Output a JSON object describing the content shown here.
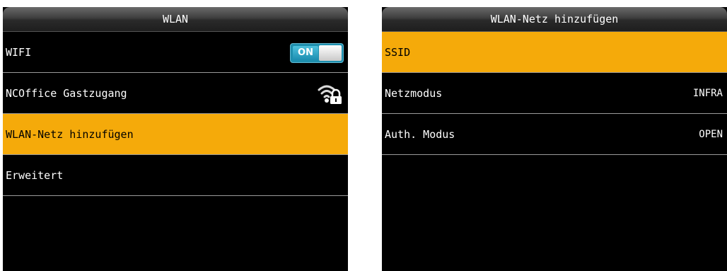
{
  "left_panel": {
    "title": "WLAN",
    "items": [
      {
        "label": "WIFI",
        "toggle": {
          "state_label": "ON",
          "on": true
        }
      },
      {
        "label": "NCOffice Gastzugang",
        "icon": "wifi-lock-icon"
      },
      {
        "label": "WLAN-Netz hinzufügen",
        "selected": true
      },
      {
        "label": "Erweitert"
      }
    ]
  },
  "right_panel": {
    "title": "WLAN-Netz hinzufügen",
    "items": [
      {
        "label": "SSID",
        "selected": true
      },
      {
        "label": "Netzmodus",
        "value": "INFRA"
      },
      {
        "label": "Auth. Modus",
        "value": "OPEN"
      }
    ]
  },
  "colors": {
    "highlight": "#f5aa0a",
    "screen_background": "#000000",
    "toggle_on": "#1e8fae",
    "divider": "#9a9a9a"
  }
}
